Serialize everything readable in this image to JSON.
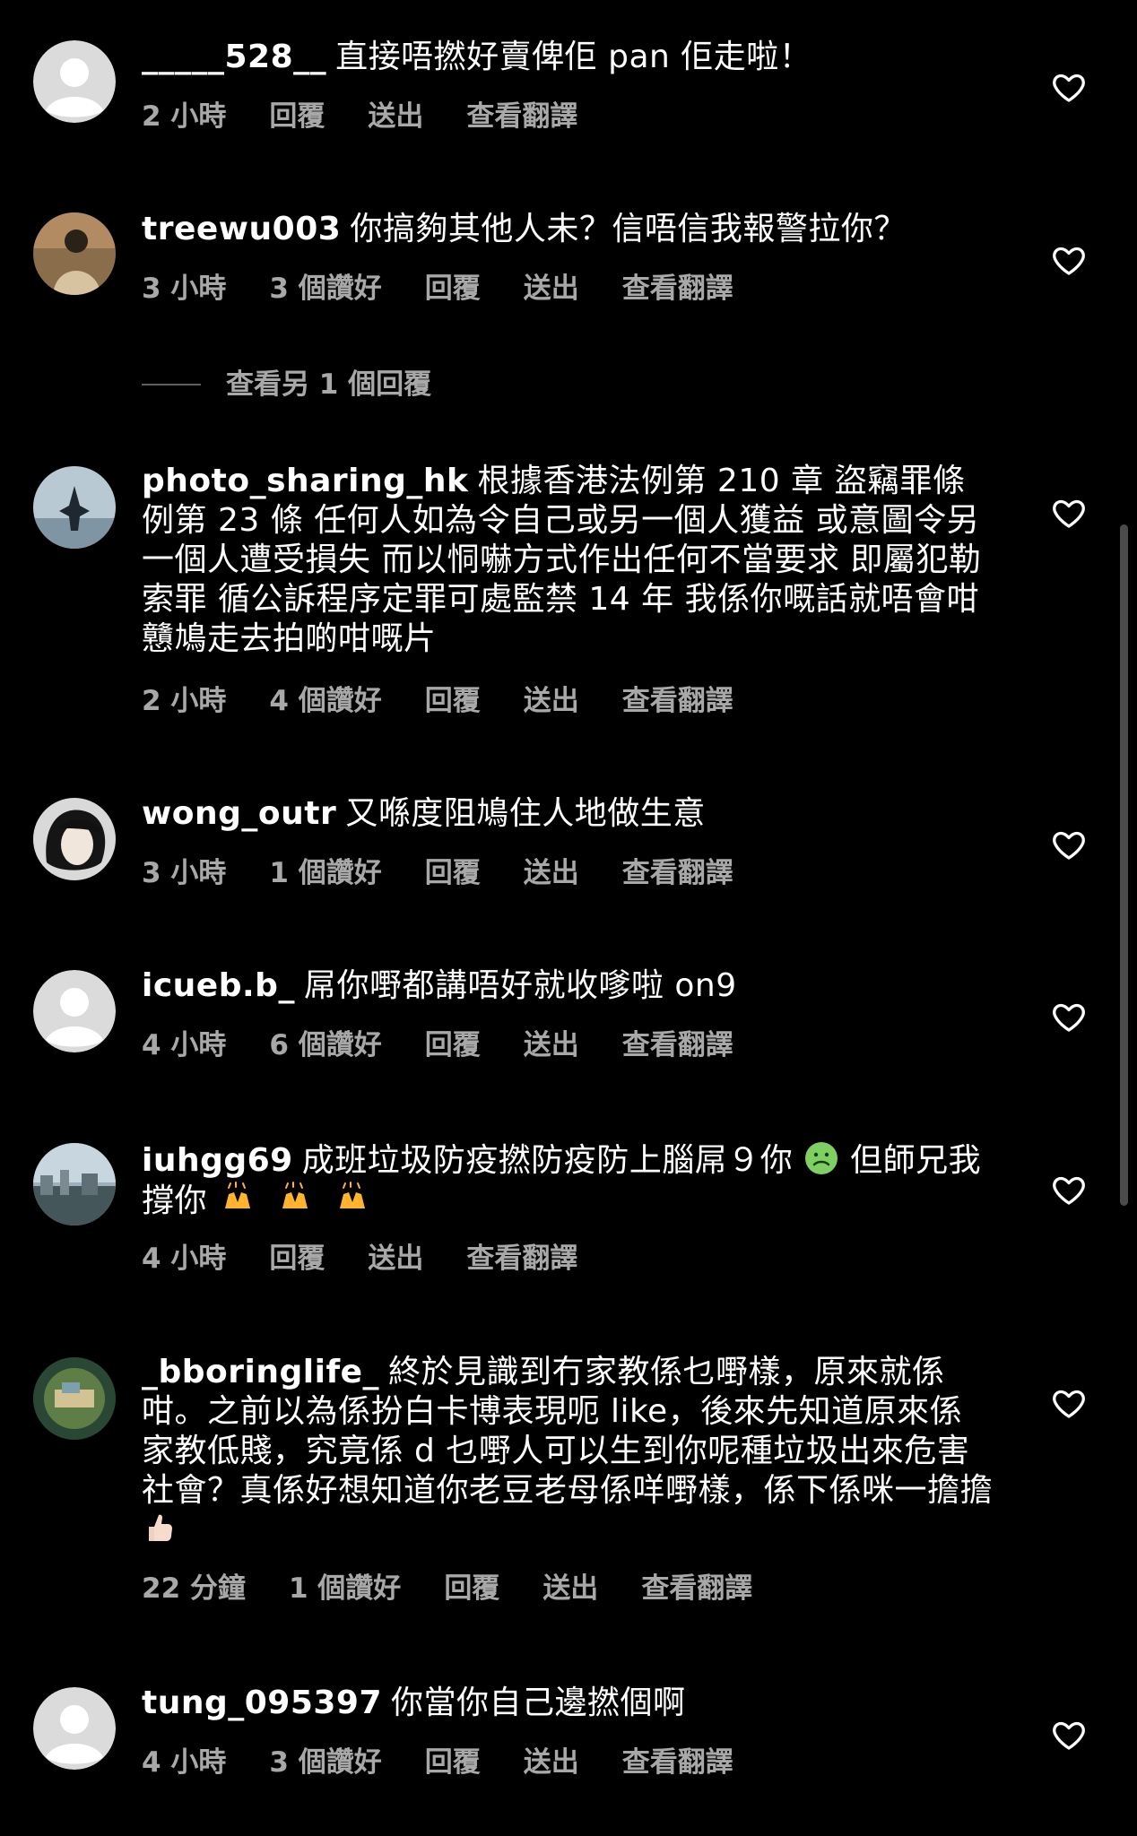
{
  "comments": [
    {
      "username": "_____528__",
      "text": "直接唔撚好賣俾佢 pan 佢走啦！",
      "time": "2 小時",
      "reply": "回覆",
      "send": "送出",
      "translate": "查看翻譯"
    },
    {
      "username": "treewu003",
      "text": "你搞夠其他人未？信唔信我報警拉你？",
      "time": "3 小時",
      "likes": "3 個讚好",
      "reply": "回覆",
      "send": "送出",
      "translate": "查看翻譯"
    },
    {
      "username": "photo_sharing_hk",
      "text": "根據香港法例第 210 章 盜竊罪條例第 23 條 任何人如為令自己或另一個人獲益 或意圖令另一個人遭受損失 而以恫嚇方式作出任何不當要求 即屬犯勒索罪 循公訴程序定罪可處監禁 14 年 我係你嘅話就唔會咁戇鳩走去拍啲咁嘅片",
      "time": "2 小時",
      "likes": "4 個讚好",
      "reply": "回覆",
      "send": "送出",
      "translate": "查看翻譯"
    },
    {
      "username": "wong_outr",
      "text": "又喺度阻鳩住人地做生意",
      "time": "3 小時",
      "likes": "1 個讚好",
      "reply": "回覆",
      "send": "送出",
      "translate": "查看翻譯"
    },
    {
      "username": "icueb.b_",
      "text": "屌你嘢都講唔好就收嗲啦 on9",
      "time": "4 小時",
      "likes": "6 個讚好",
      "reply": "回覆",
      "send": "送出",
      "translate": "查看翻譯"
    },
    {
      "username": "iuhgg69",
      "text": "成班垃圾防疫撚防疫防上腦屌９你",
      "text_after": "但師兄我撐你",
      "time": "4 小時",
      "reply": "回覆",
      "send": "送出",
      "translate": "查看翻譯"
    },
    {
      "username": "_bboringlife_",
      "text": "終於見識到冇家教係乜嘢樣，原來就係咁。之前以為係扮白卡博表現呃 like，後來先知道原來係家教低賤，究竟係 d 乜嘢人可以生到你呢種垃圾出來危害社會？真係好想知道你老豆老母係咩嘢樣，係下係咪一擔擔",
      "time": "22 分鐘",
      "likes": "1 個讚好",
      "reply": "回覆",
      "send": "送出",
      "translate": "查看翻譯"
    },
    {
      "username": "tung_095397",
      "text": "你當你自己邊撚個啊",
      "time": "4 小時",
      "likes": "3 個讚好",
      "reply": "回覆",
      "send": "送出",
      "translate": "查看翻譯"
    }
  ],
  "view_more_replies": "查看另 1 個回覆",
  "colors": {
    "background": "#000000",
    "text": "#ffffff",
    "secondary": "#a8a8a8",
    "divider": "#5f5f5f"
  },
  "icons": {
    "like": "heart-outline-icon",
    "avatar_default": "default-avatar-icon",
    "emoji_sick": "nauseated-face-emoji-icon",
    "emoji_raise_hands": "raising-hands-emoji-icon",
    "emoji_thumbs": "thumbs-up-emoji-icon"
  }
}
